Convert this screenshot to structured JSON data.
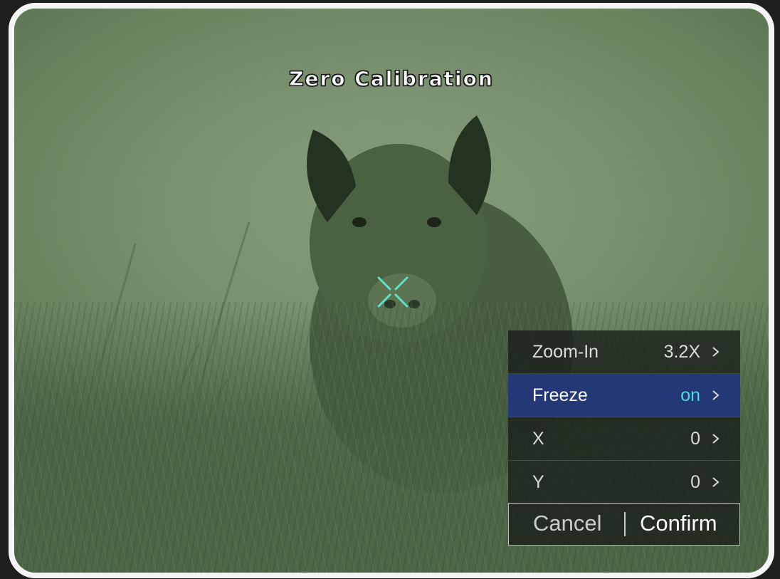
{
  "screen": {
    "title": "Zero Calibration"
  },
  "menu": {
    "items": [
      {
        "label": "Zoom-In",
        "value": "3.2X",
        "selected": false
      },
      {
        "label": "Freeze",
        "value": "on",
        "selected": true
      },
      {
        "label": "X",
        "value": "0",
        "selected": false
      },
      {
        "label": "Y",
        "value": "0",
        "selected": false
      }
    ],
    "cancel_label": "Cancel",
    "confirm_label": "Confirm"
  },
  "icons": {
    "reticle": "crosshair-x-icon",
    "chevron": "chevron-right-icon"
  },
  "colors": {
    "reticle": "#5fe3c8",
    "selected_row": "#243878",
    "selected_value": "#4fd9e0",
    "frame": "#f4f4f4"
  }
}
